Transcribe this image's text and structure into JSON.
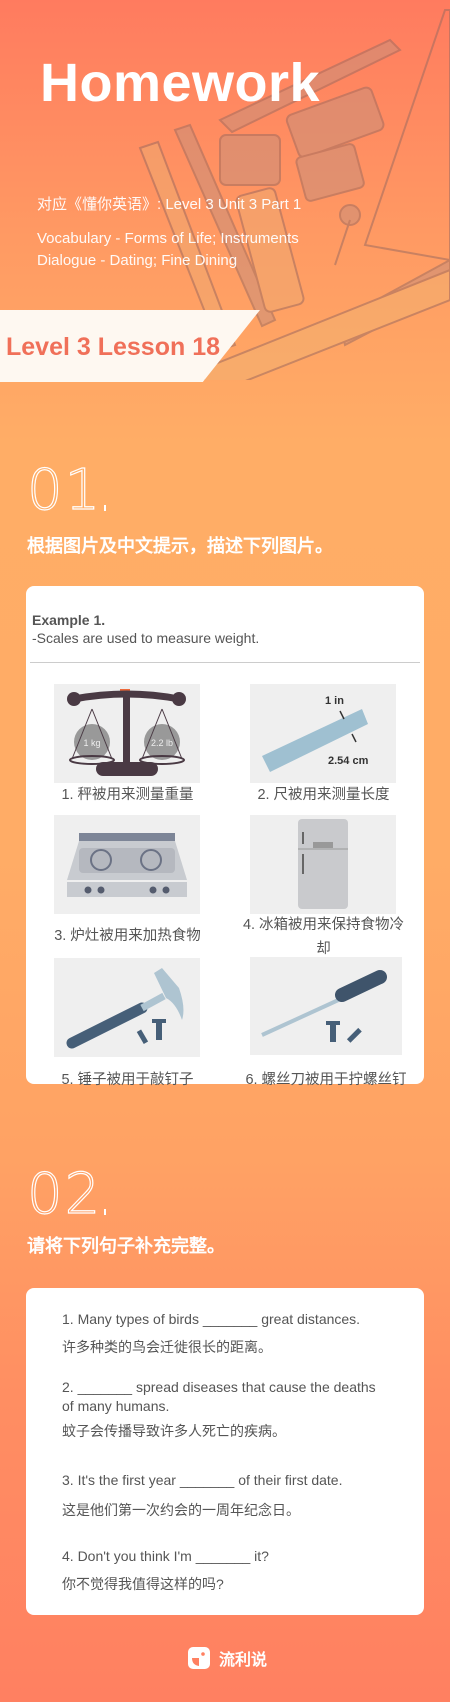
{
  "header": {
    "title": "Homework",
    "course": "对应《懂你英语》: Level 3 Unit 3 Part 1",
    "vocabulary": "Vocabulary - Forms of Life; Instruments",
    "dialogue": "Dialogue - Dating; Fine Dining",
    "lesson": "Level 3 Lesson 18"
  },
  "section1": {
    "number": "01",
    "title": "根据图片及中文提示，描述下列图片。",
    "example_heading": "Example 1.",
    "example_text": "-Scales are used to measure weight.",
    "items": [
      {
        "caption": "1. 秤被用来测量重量",
        "icon": "scale",
        "labels": [
          "1 kg",
          "2.2 lb"
        ]
      },
      {
        "caption": "2. 尺被用来测量长度",
        "icon": "ruler",
        "labels": [
          "1 in",
          "2.54 cm"
        ]
      },
      {
        "caption": "3. 炉灶被用来加热食物",
        "icon": "stove"
      },
      {
        "caption": "4. 冰箱被用来保持食物冷却",
        "icon": "refrigerator"
      },
      {
        "caption": "5. 锤子被用于敲钉子",
        "icon": "hammer"
      },
      {
        "caption": "6. 螺丝刀被用于拧螺丝钉",
        "icon": "screwdriver"
      }
    ]
  },
  "section2": {
    "number": "02",
    "title": "请将下列句子补充完整。",
    "questions": [
      {
        "en": "1. Many types of birds _______ great distances.",
        "cn": "许多种类的鸟会迁徙很长的距离。"
      },
      {
        "en": "2. _______ spread diseases that cause the deaths of many humans.",
        "cn": "蚊子会传播导致许多人死亡的疾病。"
      },
      {
        "en": "3. It's the first year _______ of their first date.",
        "cn": "这是他们第一次约会的一周年纪念日。"
      },
      {
        "en": "4. Don't you think I'm _______ it?",
        "cn": "你不觉得我值得这样的吗?"
      }
    ]
  },
  "footer": {
    "brand": "流利说"
  },
  "colors": {
    "accent": "#f07059",
    "bg_top": "#ff7b5f",
    "bg_mid": "#ffad66",
    "bg_bottom": "#ff8061"
  }
}
